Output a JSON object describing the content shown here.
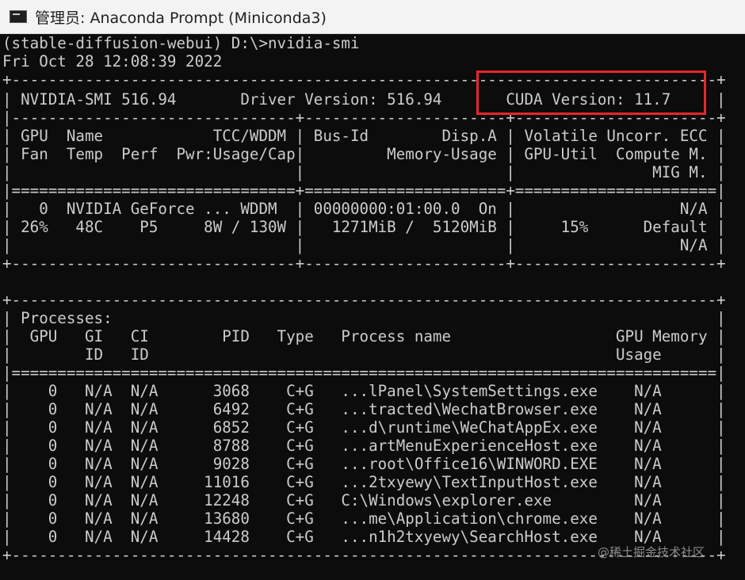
{
  "window": {
    "title": "管理员: Anaconda Prompt (Miniconda3)",
    "icon": "console-icon"
  },
  "terminal": {
    "lines": [
      "(stable-diffusion-webui) D:\\>nvidia-smi",
      "Fri Oct 28 12:08:39 2022",
      "+-----------------------------------------------------------------------------+",
      "| NVIDIA-SMI 516.94       Driver Version: 516.94       CUDA Version: 11.7     |",
      "|-------------------------------+----------------------+----------------------+",
      "| GPU  Name            TCC/WDDM | Bus-Id        Disp.A | Volatile Uncorr. ECC |",
      "| Fan  Temp  Perf  Pwr:Usage/Cap|         Memory-Usage | GPU-Util  Compute M. |",
      "|                               |                      |               MIG M. |",
      "|===============================+======================+======================|",
      "|   0  NVIDIA GeForce ... WDDM  | 00000000:01:00.0  On |                  N/A |",
      "| 26%   48C    P5     8W / 130W |   1271MiB /  5120MiB |     15%      Default |",
      "|                               |                      |                  N/A |",
      "+-------------------------------+----------------------+----------------------+",
      "",
      "+-----------------------------------------------------------------------------+",
      "| Processes:                                                                  |",
      "|  GPU   GI   CI        PID   Type   Process name                  GPU Memory |",
      "|        ID   ID                                                   Usage      |",
      "|=============================================================================|",
      "|    0   N/A  N/A      3068    C+G   ...lPanel\\SystemSettings.exe    N/A      |",
      "|    0   N/A  N/A      6492    C+G   ...tracted\\WechatBrowser.exe    N/A      |",
      "|    0   N/A  N/A      6852    C+G   ...d\\runtime\\WeChatAppEx.exe    N/A      |",
      "|    0   N/A  N/A      8788    C+G   ...artMenuExperienceHost.exe    N/A      |",
      "|    0   N/A  N/A      9028    C+G   ...root\\Office16\\WINWORD.EXE    N/A      |",
      "|    0   N/A  N/A     11016    C+G   ...2txyewy\\TextInputHost.exe    N/A      |",
      "|    0   N/A  N/A     12248    C+G   C:\\Windows\\explorer.exe         N/A      |",
      "|    0   N/A  N/A     13680    C+G   ...me\\Application\\chrome.exe    N/A      |",
      "|    0   N/A  N/A     14428    C+G   ...n1h2txyewy\\SearchHost.exe    N/A      |",
      "+-----------------------------------------------------------------------------+"
    ]
  },
  "annotation": {
    "highlight_color": "#e8262a"
  },
  "watermark": {
    "text": "@稀土掘金技术社区"
  }
}
